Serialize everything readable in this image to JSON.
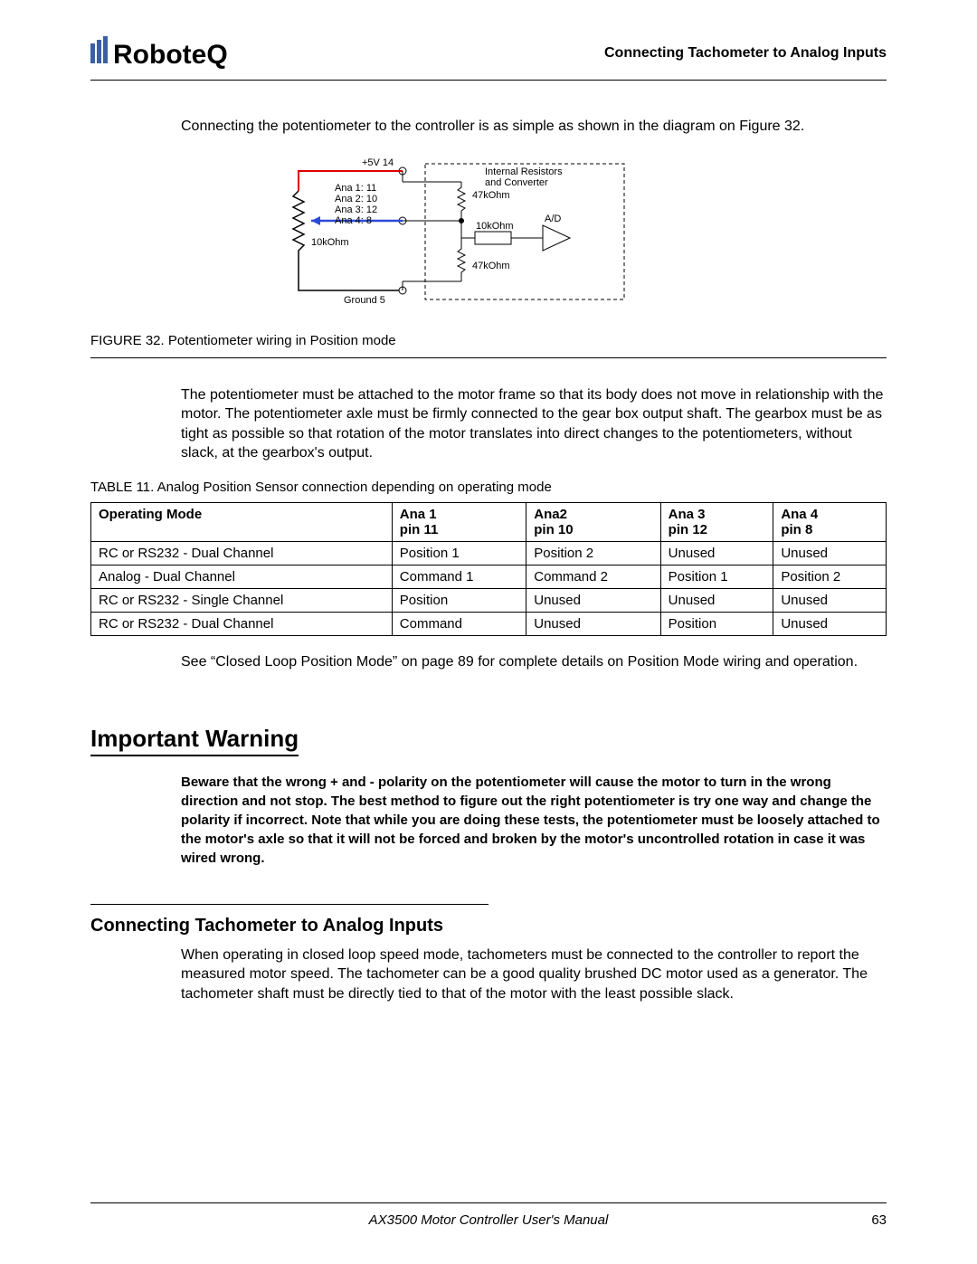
{
  "header": {
    "logo_text": "RoboteQ",
    "section_title": "Connecting Tachometer to Analog Inputs"
  },
  "para1": "Connecting the potentiometer to the controller is as simple as shown in the diagram on Figure 32.",
  "diagram": {
    "top_label": "+5V  14",
    "ana_labels": [
      "Ana 1:  11",
      "Ana 2:  10",
      "Ana 3:  12",
      "Ana 4:    8"
    ],
    "pot_label": "10kOhm",
    "r1_label": "47kOhm",
    "r2_label": "10kOhm",
    "r3_label": "47kOhm",
    "internal_label": "Internal Resistors\nand Converter",
    "ad_label": "A/D",
    "ground_label": "Ground  5"
  },
  "figure_caption": "FIGURE 32.  Potentiometer wiring in Position mode",
  "para2": "The potentiometer must be attached to the motor frame so that its body does not move in relationship with the motor. The potentiometer axle must be firmly connected to the gear box output shaft. The gearbox must be as tight as possible so that rotation of the motor translates into direct changes to the potentiometers, without slack, at the gearbox's output.",
  "table_caption": "TABLE 11. Analog Position Sensor connection depending on operating mode",
  "table": {
    "headers": [
      "Operating Mode",
      "Ana 1\npin 11",
      "Ana2\npin 10",
      "Ana 3\npin 12",
      "Ana 4\npin 8"
    ],
    "rows": [
      [
        "RC or RS232 - Dual Channel",
        "Position 1",
        "Position 2",
        "Unused",
        "Unused"
      ],
      [
        "Analog - Dual Channel",
        "Command 1",
        "Command 2",
        "Position 1",
        "Position 2"
      ],
      [
        "RC or RS232 - Single Channel",
        "Position",
        "Unused",
        "Unused",
        "Unused"
      ],
      [
        "RC or RS232 - Dual Channel",
        "Command",
        "Unused",
        "Position",
        "Unused"
      ]
    ]
  },
  "para3": "See “Closed Loop Position Mode” on page 89 for complete details on Position Mode wiring and operation.",
  "warning_heading": "Important Warning",
  "warning_text": "Beware that the wrong + and - polarity on the potentiometer will cause the motor to turn in the wrong direction and not stop. The best method to figure out the right potentiometer is try one way and change the polarity if incorrect. Note that while you are doing these tests, the potentiometer must be loosely attached to the motor's axle so that it will not be forced and broken by the motor's uncontrolled rotation in case it was wired wrong.",
  "section_heading": "Connecting Tachometer to Analog Inputs",
  "para4": "When operating in closed loop speed mode, tachometers must be connected to the controller to report the measured motor speed. The tachometer can be a good quality brushed DC motor used as a generator. The tachometer shaft must be directly tied to that of the motor with the least possible slack.",
  "footer": {
    "manual": "AX3500 Motor Controller User's Manual",
    "page": "63"
  }
}
